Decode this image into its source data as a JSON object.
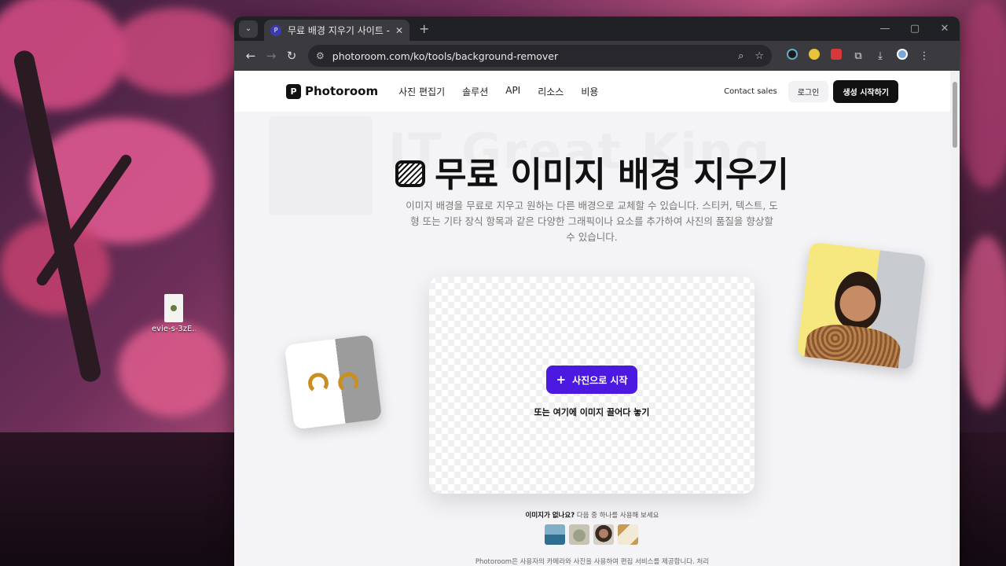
{
  "desktop": {
    "file_name": "evie-s-3zE...",
    "colors": {
      "blossom": "#e0508a",
      "trunk": "#2a1a22"
    }
  },
  "browser": {
    "tab": {
      "favicon": "photoroom-favicon",
      "title": "무료 배경 지우기 사이트 - 온라",
      "close": "✕"
    },
    "new_tab": "+",
    "window_controls": [
      "—",
      "▢",
      "✕"
    ],
    "url": "photoroom.com/ko/tools/background-remover",
    "extensions": [
      "zoom-icon",
      "star-icon",
      "extension-1",
      "extension-2",
      "extension-new",
      "puzzle-icon",
      "download-icon",
      "profile-avatar",
      "menu-icon"
    ]
  },
  "site": {
    "logo": "Photoroom",
    "nav": [
      "사진 편집기",
      "솔루션",
      "API",
      "리소스",
      "비용"
    ],
    "contact_sales": "Contact sales",
    "login": "로그인",
    "cta": "생성 시작하기",
    "ghost_text": "IT Great King"
  },
  "hero": {
    "title": "무료 이미지 배경 지우기",
    "subtitle": "이미지 배경을 무료로 지우고 원하는 다른 배경으로 교체할 수 있습니다. 스티커, 텍스트, 도형 또는 기타 장식 항목과 같은 다양한 그래픽이나 요소를 추가하여 사진의 품질을 향상할 수 있습니다.",
    "start_button": "사진으로 시작",
    "drop_text": "또는 여기에 이미지 끌어다 놓기",
    "accent": "#4b19e0"
  },
  "samples": {
    "question_bold": "이미지가 없나요?",
    "question_rest": " 다음 중 하나를 사용해 보세요",
    "thumbs": [
      "car",
      "shoes",
      "woman",
      "paper"
    ]
  },
  "footnote": "Photoroom은 사용자의 카메라와 사진을 사용하여 편집 서비스를 제공합니다. 처리"
}
